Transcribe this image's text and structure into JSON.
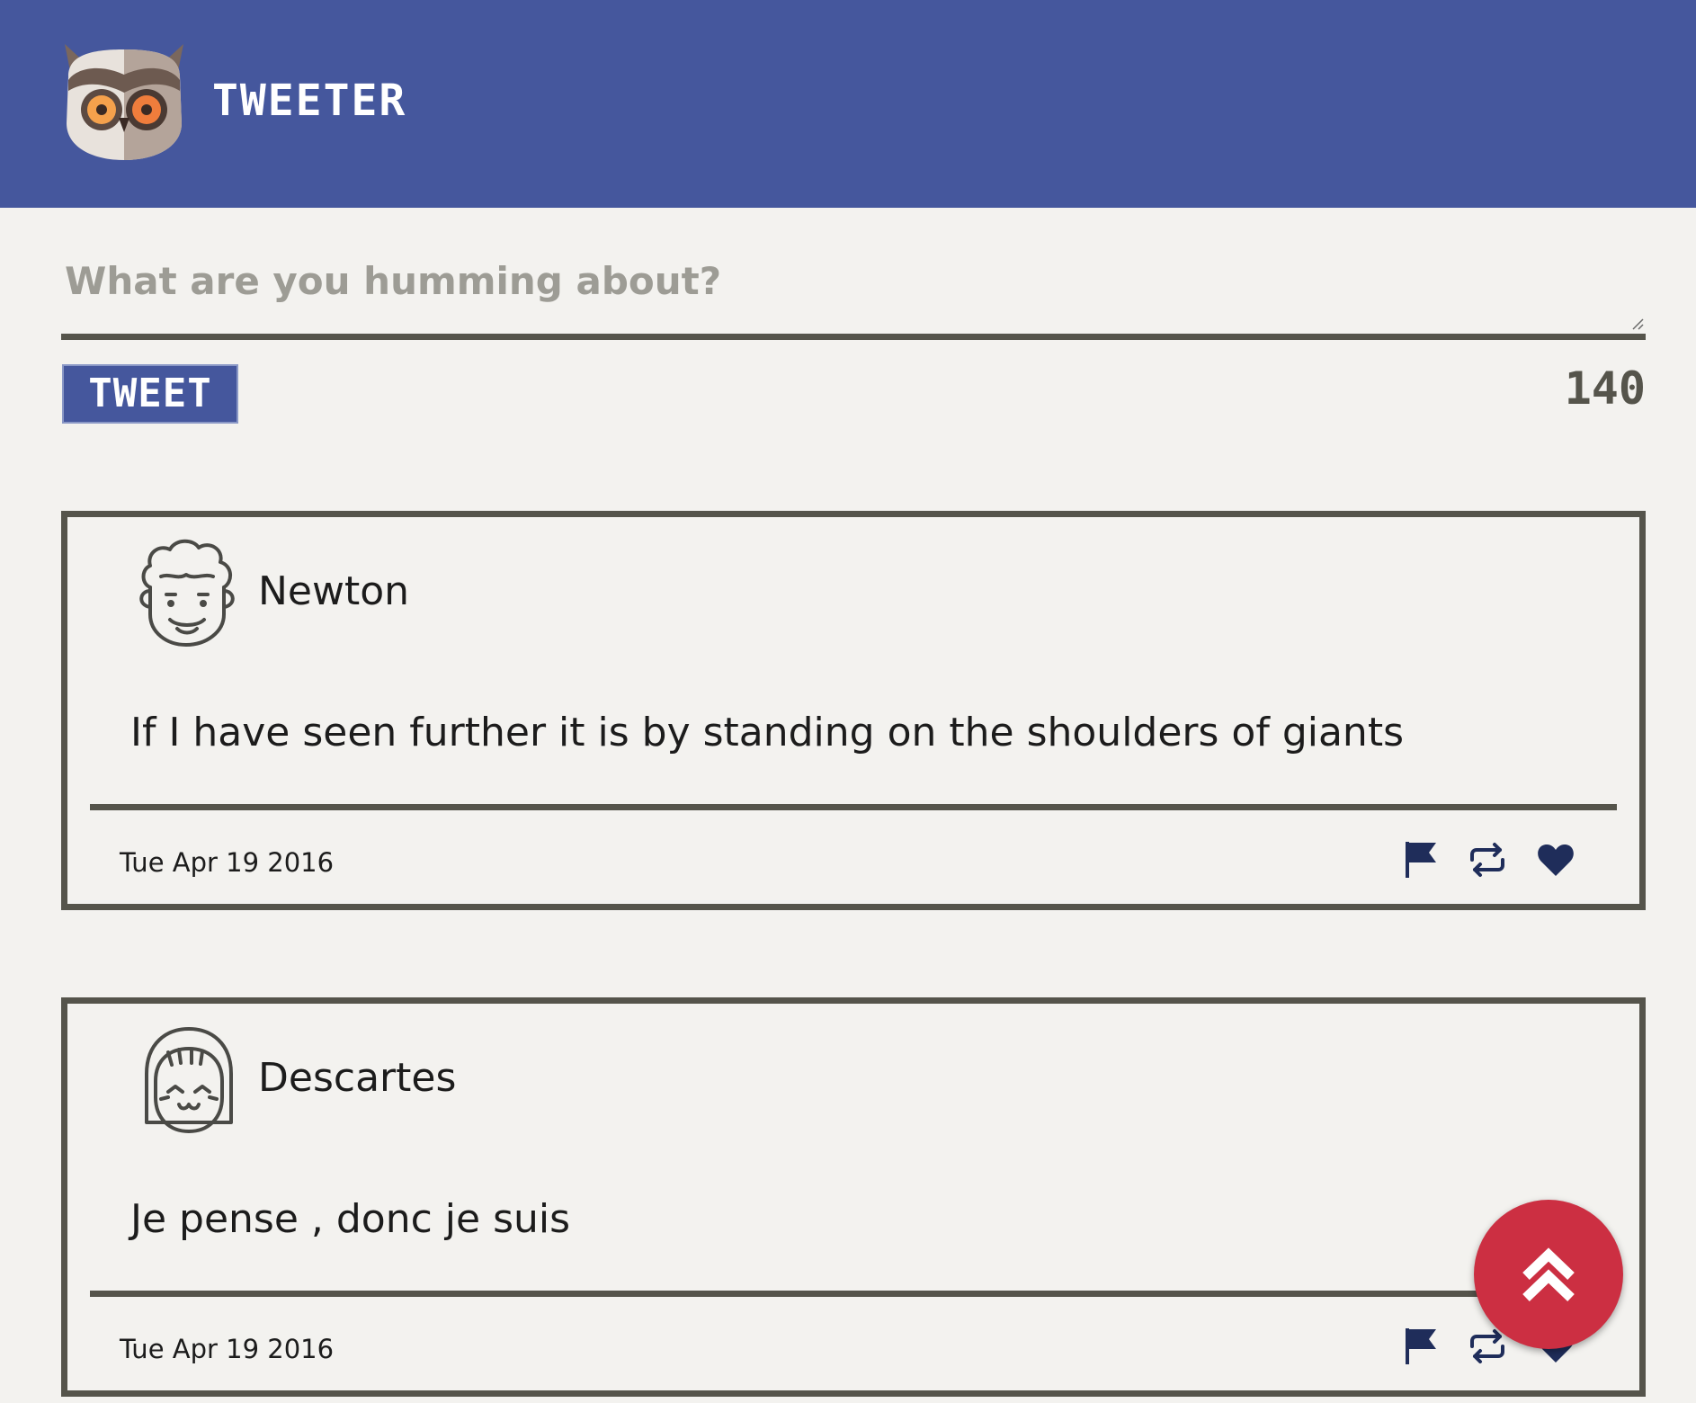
{
  "header": {
    "brand": "TWEETER",
    "logo_icon": "owl-icon",
    "background": "#45579d"
  },
  "composer": {
    "placeholder": "What are you humming about?",
    "value": "",
    "submit_label": "TWEET",
    "char_counter": "140"
  },
  "tweets": [
    {
      "author": "Newton",
      "avatar_icon": "curly-hair-avatar-icon",
      "text": "If I have seen further it is by standing on the shoulders of giants",
      "date": "Tue Apr 19 2016",
      "actions": [
        "flag-icon",
        "retweet-icon",
        "heart-icon"
      ]
    },
    {
      "author": "Descartes",
      "avatar_icon": "bob-hair-avatar-icon",
      "text": "Je pense , donc je suis",
      "date": "Tue Apr 19 2016",
      "actions": [
        "flag-icon",
        "retweet-icon",
        "heart-icon"
      ]
    }
  ],
  "fab": {
    "icon": "double-chevron-up-icon",
    "color": "#cc2f42"
  },
  "colors": {
    "accent": "#45579d",
    "border": "#55544b",
    "background": "#f3f2ef",
    "action_icons": "#1f2d5a"
  }
}
